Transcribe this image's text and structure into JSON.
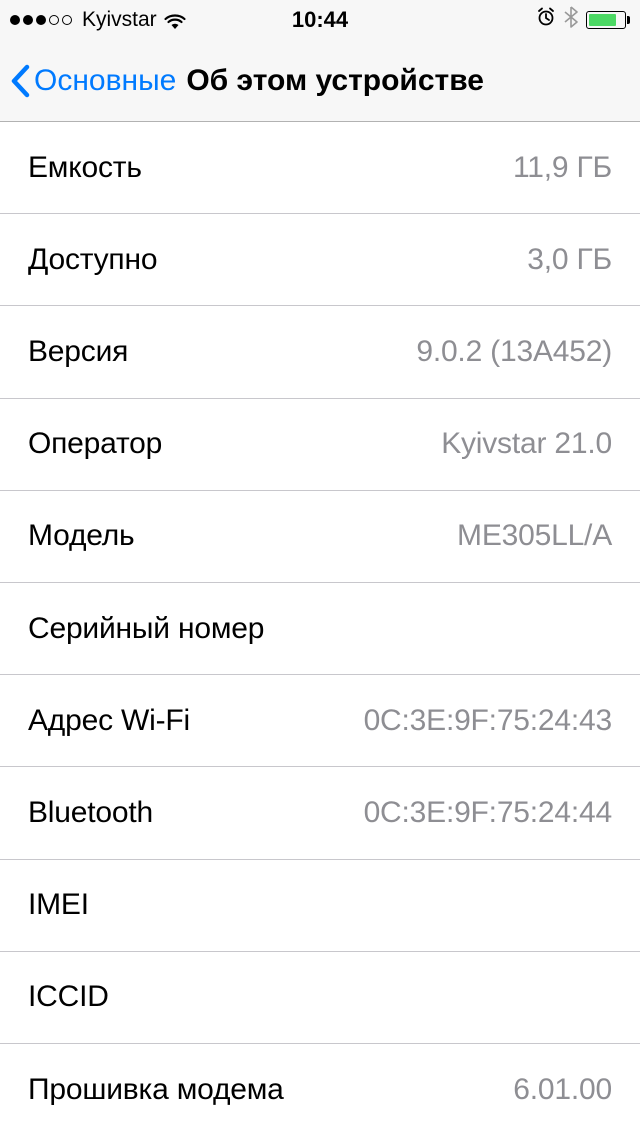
{
  "statusBar": {
    "carrier": "Kyivstar",
    "time": "10:44"
  },
  "navBar": {
    "backLabel": "Основные",
    "title": "Об этом устройстве"
  },
  "rows": [
    {
      "label": "Емкость",
      "value": "11,9 ГБ"
    },
    {
      "label": "Доступно",
      "value": "3,0 ГБ"
    },
    {
      "label": "Версия",
      "value": "9.0.2 (13A452)"
    },
    {
      "label": "Оператор",
      "value": "Kyivstar 21.0"
    },
    {
      "label": "Модель",
      "value": "ME305LL/A"
    },
    {
      "label": "Серийный номер",
      "value": ""
    },
    {
      "label": "Адрес Wi-Fi",
      "value": "0C:3E:9F:75:24:43"
    },
    {
      "label": "Bluetooth",
      "value": "0C:3E:9F:75:24:44"
    },
    {
      "label": "IMEI",
      "value": ""
    },
    {
      "label": "ICCID",
      "value": ""
    },
    {
      "label": "Прошивка модема",
      "value": "6.01.00"
    }
  ]
}
